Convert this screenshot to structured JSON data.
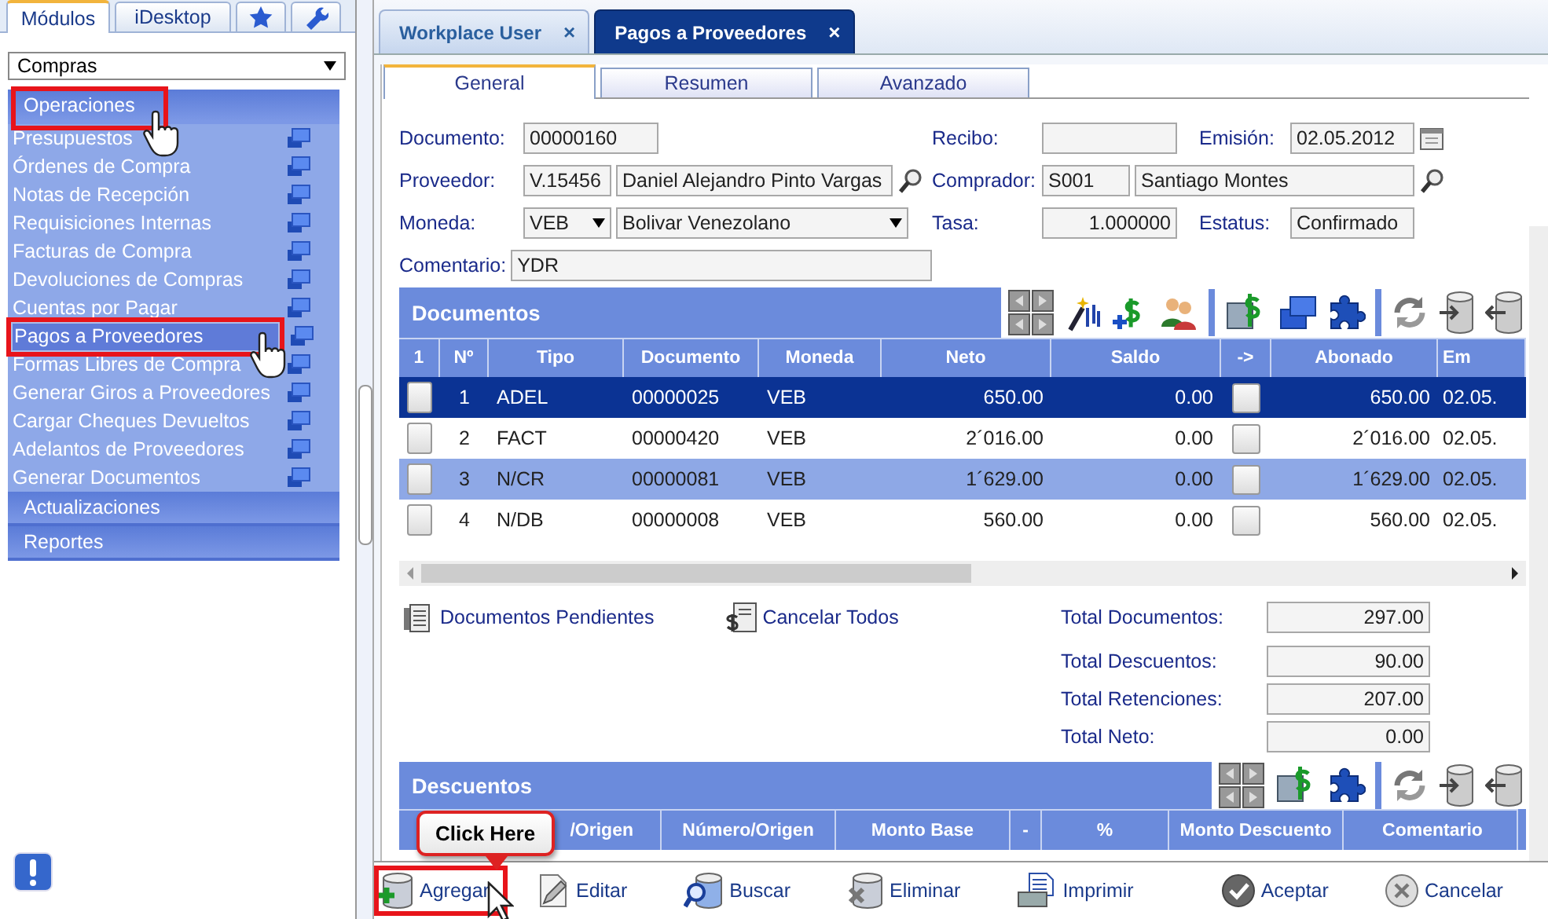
{
  "sidebar": {
    "tabs": [
      {
        "kind": "text",
        "label": "Módulos",
        "selected": true
      },
      {
        "kind": "text",
        "label": "iDesktop",
        "selected": false
      },
      {
        "kind": "star",
        "selected": false
      },
      {
        "kind": "wrench",
        "selected": false
      }
    ],
    "module_select": {
      "value": "Compras"
    },
    "sections": [
      {
        "label": "Operaciones",
        "expanded": true,
        "highlighted": true,
        "cursor": true,
        "items": [
          {
            "label": "Presupuestos",
            "selected": false
          },
          {
            "label": "Órdenes de Compra",
            "selected": false
          },
          {
            "label": "Notas de Recepción",
            "selected": false
          },
          {
            "label": "Requisiciones Internas",
            "selected": false
          },
          {
            "label": "Facturas de Compra",
            "selected": false
          },
          {
            "label": "Devoluciones de Compras",
            "selected": false
          },
          {
            "label": "Cuentas por Pagar",
            "selected": false
          },
          {
            "label": "Pagos a Proveedores",
            "selected": true,
            "highlighted": true,
            "cursor": true
          },
          {
            "label": "Formas Libres de Compra",
            "selected": false
          },
          {
            "label": "Generar Giros a Proveedores",
            "selected": false
          },
          {
            "label": "Cargar Cheques Devueltos",
            "selected": false
          },
          {
            "label": "Adelantos de Proveedores",
            "selected": false
          },
          {
            "label": "Generar Documentos",
            "selected": false
          }
        ]
      },
      {
        "label": "Actualizaciones",
        "expanded": false
      },
      {
        "label": "Reportes",
        "expanded": false
      }
    ]
  },
  "document_tabs": [
    {
      "label": "Workplace User",
      "close": "×",
      "selected": false
    },
    {
      "label": "Pagos a Proveedores",
      "close": "×",
      "selected": true
    }
  ],
  "form_tabs": [
    {
      "label": "General",
      "selected": true
    },
    {
      "label": "Resumen",
      "selected": false
    },
    {
      "label": "Avanzado",
      "selected": false
    }
  ],
  "form": {
    "rows": [
      {
        "cells": [
          {
            "label": "Documento:",
            "inputs": [
              {
                "kind": "text",
                "value": "00000160"
              }
            ]
          },
          {
            "label": "Recibo:",
            "inputs": [
              {
                "kind": "text"
              }
            ]
          },
          {
            "label": "Emisión:",
            "inputs": [
              {
                "kind": "date",
                "value": "02.05.2012"
              }
            ]
          }
        ]
      },
      {
        "cells": [
          {
            "label": "Proveedor:",
            "inputs": [
              {
                "kind": "text",
                "value": "V.15456"
              },
              {
                "kind": "lookup",
                "value": "Daniel Alejandro Pinto Vargas"
              }
            ]
          },
          {
            "label": "Comprador:",
            "inputs": [
              {
                "kind": "text",
                "value": "S001"
              },
              {
                "kind": "lookup",
                "value": "Santiago Montes"
              }
            ]
          }
        ]
      },
      {
        "cells": [
          {
            "label": "Moneda:",
            "inputs": [
              {
                "kind": "select",
                "value": "VEB"
              },
              {
                "kind": "select",
                "value": "Bolivar Venezolano"
              }
            ]
          },
          {
            "label": "Tasa:",
            "inputs": [
              {
                "kind": "number",
                "value": "1.000000"
              }
            ]
          },
          {
            "label": "Estatus:",
            "inputs": [
              {
                "kind": "text",
                "value": "Confirmado"
              }
            ]
          }
        ]
      },
      {
        "cells": [
          {
            "label": "Comentario:",
            "inputs": [
              {
                "kind": "text",
                "value": "YDR"
              }
            ]
          }
        ]
      }
    ]
  },
  "documents": {
    "title": "Documentos",
    "toolbar": [
      {
        "kind": "nav"
      },
      {
        "kind": "wand"
      },
      {
        "kind": "dollar-add"
      },
      {
        "kind": "people"
      },
      {
        "kind": "separator"
      },
      {
        "kind": "dollar-edit"
      },
      {
        "kind": "window"
      },
      {
        "kind": "puzzle"
      },
      {
        "kind": "separator"
      },
      {
        "kind": "refresh"
      },
      {
        "kind": "db-in"
      },
      {
        "kind": "db-out"
      }
    ],
    "columns": [
      "1",
      "Nº",
      "Tipo",
      "Documento",
      "Moneda",
      "Neto",
      "Saldo",
      "->",
      "Abonado",
      "Em"
    ],
    "rows": [
      {
        "no": "1",
        "tipo": "ADEL",
        "documento": "00000025",
        "moneda": "VEB",
        "neto": "650.00",
        "saldo": "0.00",
        "checked": false,
        "abonado": "650.00",
        "column_10": "02.05.",
        "selected": true,
        "highlighted": false
      },
      {
        "no": "2",
        "tipo": "FACT",
        "documento": "00000420",
        "moneda": "VEB",
        "neto": "2´016.00",
        "saldo": "0.00",
        "checked": false,
        "abonado": "2´016.00",
        "column_10": "02.05.",
        "selected": false,
        "highlighted": false
      },
      {
        "no": "3",
        "tipo": "N/CR",
        "documento": "00000081",
        "moneda": "VEB",
        "neto": "1´629.00",
        "saldo": "0.00",
        "checked": false,
        "abonado": "1´629.00",
        "column_10": "02.05.",
        "selected": false,
        "highlighted": true
      },
      {
        "no": "4",
        "tipo": "N/DB",
        "documento": "00000008",
        "moneda": "VEB",
        "neto": "560.00",
        "saldo": "0.00",
        "checked": false,
        "abonado": "560.00",
        "column_10": "02.05.",
        "selected": false,
        "highlighted": false
      }
    ]
  },
  "links": [
    {
      "kind": "pending",
      "label": "Documentos Pendientes"
    },
    {
      "kind": "cancel-all",
      "label": "Cancelar Todos"
    }
  ],
  "totals": [
    {
      "label": "Total Documentos:",
      "value": "297.00"
    },
    {
      "label": "Total Descuentos:",
      "value": "90.00"
    },
    {
      "label": "Total Retenciones:",
      "value": "207.00"
    },
    {
      "label": "Total Neto:",
      "value": "0.00"
    }
  ],
  "discounts": {
    "title": "Descuentos",
    "toolbar": [
      {
        "kind": "nav"
      },
      {
        "kind": "dollar-edit"
      },
      {
        "kind": "puzzle"
      },
      {
        "kind": "separator"
      },
      {
        "kind": "refresh"
      },
      {
        "kind": "db-in"
      },
      {
        "kind": "db-out"
      }
    ],
    "columns": [
      "/Origen",
      "Número/Origen",
      "Monto Base",
      "-",
      "%",
      "Monto Descuento",
      "Comentario"
    ]
  },
  "actions": [
    {
      "kind": "add",
      "label": "Agregar",
      "highlighted": true,
      "cursor": true
    },
    {
      "kind": "edit",
      "label": "Editar"
    },
    {
      "kind": "search",
      "label": "Buscar"
    },
    {
      "kind": "delete",
      "label": "Eliminar"
    },
    {
      "kind": "print",
      "label": "Imprimir"
    },
    {
      "kind": "accept",
      "label": "Aceptar"
    },
    {
      "kind": "cancel",
      "label": "Cancelar"
    }
  ],
  "callout": {
    "text": "Click Here"
  }
}
